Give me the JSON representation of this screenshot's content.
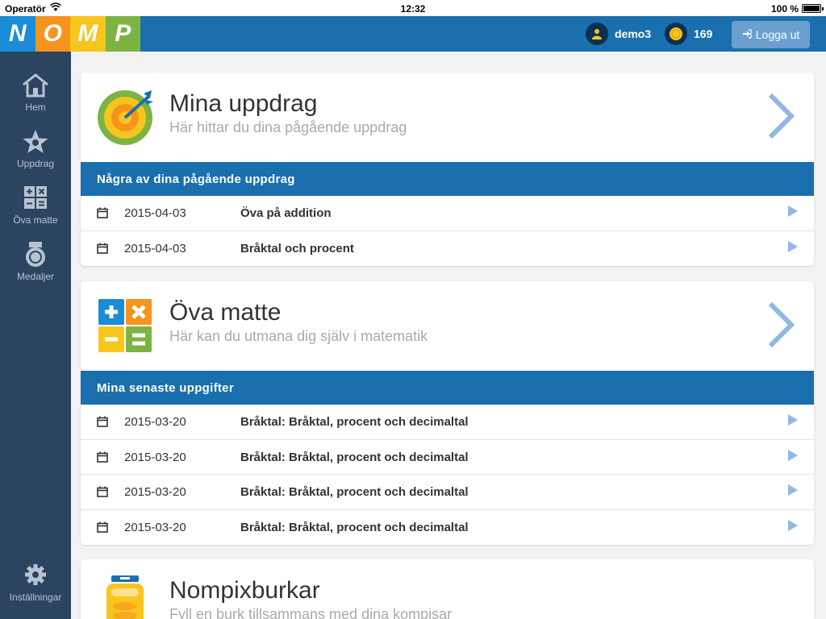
{
  "status_bar": {
    "carrier": "Operatör",
    "time": "12:32",
    "battery": "100 %"
  },
  "logo": {
    "letters": [
      "N",
      "O",
      "M",
      "P"
    ]
  },
  "header": {
    "username": "demo3",
    "coins": "169",
    "logout_label": "Logga ut"
  },
  "sidebar": {
    "items": [
      {
        "label": "Hem",
        "icon": "home-icon"
      },
      {
        "label": "Uppdrag",
        "icon": "star-icon"
      },
      {
        "label": "Öva matte",
        "icon": "calculator-icon"
      },
      {
        "label": "Medaljer",
        "icon": "medal-icon"
      }
    ],
    "settings_label": "Inställningar"
  },
  "missions": {
    "title": "Mina uppdrag",
    "subtitle": "Här hittar du dina pågående uppdrag",
    "band": "Några av dina pågående uppdrag",
    "rows": [
      {
        "date": "2015-04-03",
        "name": "Öva på addition"
      },
      {
        "date": "2015-04-03",
        "name": "Bråktal och procent"
      }
    ]
  },
  "practice": {
    "title": "Öva matte",
    "subtitle": "Här kan du utmana dig själv i matematik",
    "band": "Mina senaste uppgifter",
    "rows": [
      {
        "date": "2015-03-20",
        "name": "Bråktal: Bråktal, procent och decimaltal"
      },
      {
        "date": "2015-03-20",
        "name": "Bråktal: Bråktal, procent och decimaltal"
      },
      {
        "date": "2015-03-20",
        "name": "Bråktal: Bråktal, procent och decimaltal"
      },
      {
        "date": "2015-03-20",
        "name": "Bråktal: Bråktal, procent och decimaltal"
      }
    ]
  },
  "jars": {
    "title": "Nompixburkar",
    "subtitle": "Fyll en burk tillsammans med dina kompisar"
  },
  "colors": {
    "brand_blue": "#1a6fae",
    "sidebar": "#2b4460",
    "chevron": "#8fb8e6"
  }
}
